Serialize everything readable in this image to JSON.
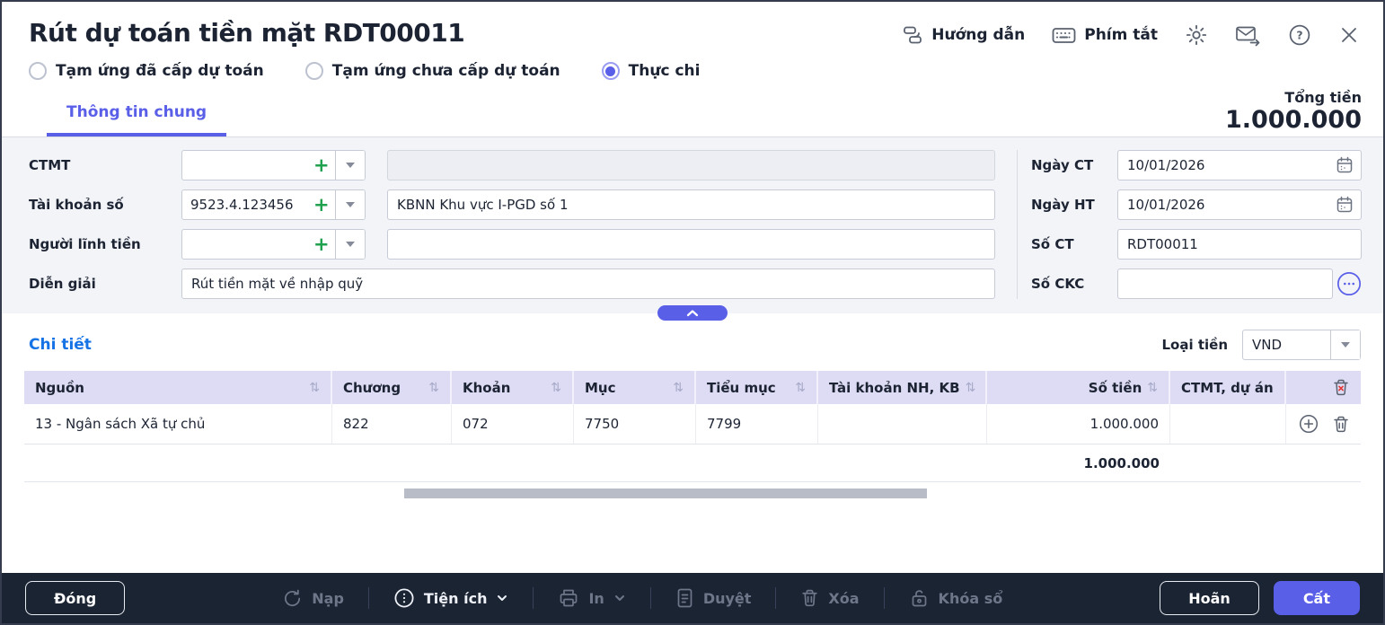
{
  "window": {
    "title": "Rút dự toán tiền mặt RDT00011"
  },
  "header": {
    "guide": "Hướng dẫn",
    "shortcuts": "Phím tắt",
    "icons": [
      "guide-icon",
      "keyboard-icon",
      "gear-icon",
      "mail-send-icon",
      "help-icon",
      "close-icon"
    ]
  },
  "voucher_types": [
    {
      "label": "Tạm ứng đã cấp dự toán",
      "selected": false
    },
    {
      "label": "Tạm ứng chưa cấp dự toán",
      "selected": false
    },
    {
      "label": "Thực chi",
      "selected": true
    }
  ],
  "tabs": {
    "general": "Thông tin chung"
  },
  "total": {
    "label": "Tổng tiền",
    "value": "1.000.000"
  },
  "form": {
    "ctmt_label": "CTMT",
    "ctmt_value": "",
    "ctmt_name": "",
    "account_label": "Tài khoản số",
    "account_value": "9523.4.123456",
    "account_name": "KBNN Khu vực I-PGD số 1",
    "payee_label": "Người lĩnh tiền",
    "payee_value": "",
    "payee_name": "",
    "desc_label": "Diễn giải",
    "desc_value": "Rút tiền mặt về nhập quỹ",
    "date_ct_label": "Ngày CT",
    "date_ct_value": "10/01/2026",
    "date_ht_label": "Ngày HT",
    "date_ht_value": "10/01/2026",
    "doc_no_label": "Số CT",
    "doc_no_value": "RDT00011",
    "ckc_label": "Số CKC",
    "ckc_value": ""
  },
  "detail": {
    "title": "Chi tiết",
    "currency_label": "Loại tiền",
    "currency_value": "VND",
    "table": {
      "columns": [
        "Nguồn",
        "Chương",
        "Khoản",
        "Mục",
        "Tiểu mục",
        "Tài khoản NH, KB",
        "Số tiền",
        "CTMT, dự án"
      ],
      "rows": [
        [
          "13 - Ngân sách Xã tự chủ",
          "822",
          "072",
          "7750",
          "7799",
          "",
          "1.000.000",
          ""
        ]
      ],
      "total": "1.000.000"
    }
  },
  "toolbar": {
    "close": "Đóng",
    "load": "Nạp",
    "utilities": "Tiện ích",
    "print": "In",
    "approve": "Duyệt",
    "delete": "Xóa",
    "lock": "Khóa sổ",
    "postpone": "Hoãn",
    "save": "Cất"
  },
  "colors": {
    "accent": "#5a5fe8",
    "link_blue": "#1673e6",
    "green_plus": "#1fa14e",
    "toolbar_bg": "#1b2433",
    "table_header_bg": "#dedcf4"
  }
}
